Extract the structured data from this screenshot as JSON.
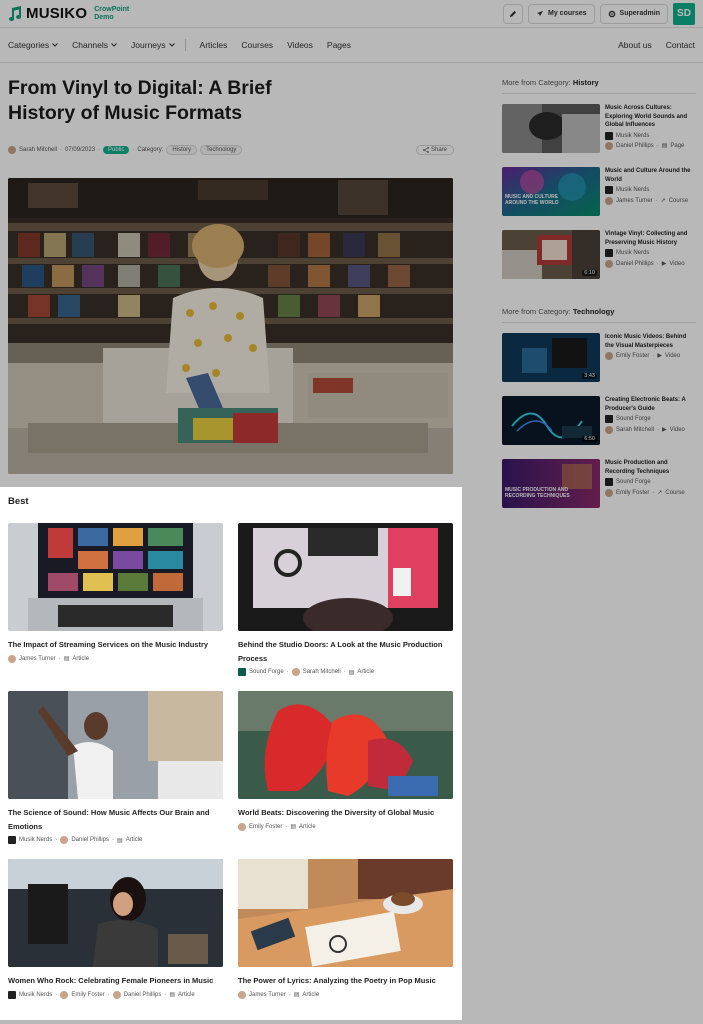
{
  "app": {
    "logo_text": "MUSIKO",
    "logo_sub": "CrowPoint Demo",
    "my_courses": "My courses",
    "superadmin": "Superadmin",
    "avatar_initials": "SD"
  },
  "nav": {
    "left": [
      "Categories",
      "Channels",
      "Journeys"
    ],
    "left2": [
      "Articles",
      "Courses",
      "Videos",
      "Pages"
    ],
    "right": [
      "About us",
      "Contact"
    ]
  },
  "article": {
    "title": "From Vinyl to Digital: A Brief History of Music Formats",
    "author": "Sarah Mitchell",
    "date": "07/09/2023",
    "status": "Public",
    "category_label": "Category:",
    "tags": [
      "History",
      "Technology"
    ],
    "share": "Share"
  },
  "best": {
    "heading": "Best",
    "cards": [
      {
        "title": "The Impact of Streaming Services on the Music Industry",
        "authors": [
          "James Turner"
        ],
        "type": "Article"
      },
      {
        "title": "Behind the Studio Doors: A Look at the Music Production Process",
        "authors": [
          "Sound Forge",
          "Sarah Mitchell"
        ],
        "type": "Article"
      },
      {
        "title": "The Science of Sound: How Music Affects Our Brain and Emotions",
        "authors": [
          "Musik Nerds",
          "Daniel Phillips"
        ],
        "type": "Article"
      },
      {
        "title": "World Beats: Discovering the Diversity of Global Music",
        "authors": [
          "Emily Foster"
        ],
        "type": "Article"
      },
      {
        "title": "Women Who Rock: Celebrating Female Pioneers in Music",
        "authors": [
          "Musik Nerds",
          "Emily Foster",
          "Daniel Phillips"
        ],
        "type": "Article"
      },
      {
        "title": "The Power of Lyrics: Analyzing the Poetry in Pop Music",
        "authors": [
          "James Turner"
        ],
        "type": "Article"
      }
    ]
  },
  "sidebar": {
    "groups": [
      {
        "label": "More from Category:",
        "category": "History",
        "items": [
          {
            "title": "Music Across Cultures: Exploring World Sounds and Global Influences",
            "channel": "Musik Nerds",
            "author": "Daniel Phillips",
            "type": "Page",
            "duration": "",
            "overlay": ""
          },
          {
            "title": "Music and Culture Around the World",
            "channel": "Musik Nerds",
            "author": "James Turner",
            "type": "Course",
            "duration": "",
            "overlay": "MUSIC AND CULTURE AROUND THE WORLD"
          },
          {
            "title": "Vintage Vinyl: Collecting and Preserving Music History",
            "channel": "Musik Nerds",
            "author": "Daniel Phillips",
            "type": "Video",
            "duration": "6:10",
            "overlay": ""
          }
        ]
      },
      {
        "label": "More from Category:",
        "category": "Technology",
        "items": [
          {
            "title": "Iconic Music Videos: Behind the Visual Masterpieces",
            "channel": "",
            "author": "Emily Foster",
            "type": "Video",
            "duration": "3:43",
            "overlay": ""
          },
          {
            "title": "Creating Electronic Beats: A Producer's Guide",
            "channel": "Sound Forge",
            "author": "Sarah Mitchell",
            "type": "Video",
            "duration": "6:50",
            "overlay": ""
          },
          {
            "title": "Music Production and Recording Techniques",
            "channel": "Sound Forge",
            "author": "Emily Foster",
            "type": "Course",
            "duration": "",
            "overlay": "MUSIC PRODUCTION AND RECORDING TECHNIQUES"
          }
        ]
      }
    ]
  },
  "colors": {
    "accent": "#10b08e"
  }
}
